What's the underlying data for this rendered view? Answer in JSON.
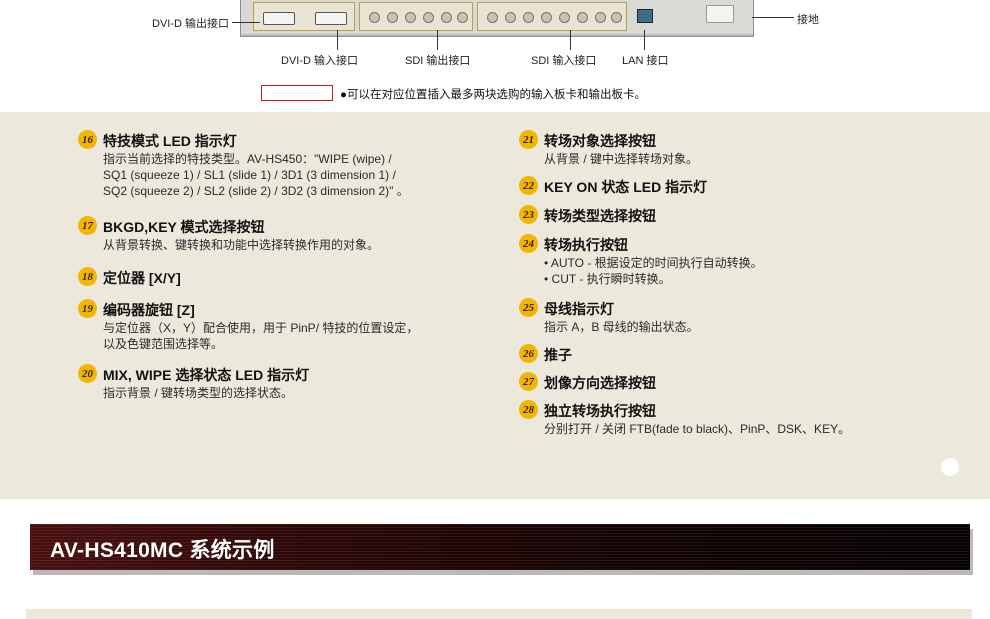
{
  "rear_panel": {
    "labels": {
      "dvi_out": "DVI-D 输出接口",
      "dvi_in": "DVI-D 输入接口",
      "sdi_out": "SDI 输出接口",
      "sdi_in": "SDI 输入接口",
      "lan": "LAN 接口",
      "ground": "接地"
    },
    "legend_note": "●可以在对应位置插入最多两块选购的输入板卡和输出板卡。"
  },
  "items": [
    {
      "num": "16",
      "title": "特技模式 LED 指示灯",
      "body": [
        "指示当前选择的特技类型。AV-HS450：\"WIPE (wipe) /",
        "SQ1 (squeeze 1) / SL1 (slide 1) / 3D1 (3 dimension 1) /",
        "SQ2 (squeeze 2) / SL2 (slide 2) / 3D2 (3 dimension 2)\" 。"
      ]
    },
    {
      "num": "17",
      "title": "BKGD,KEY 模式选择按钮",
      "body": [
        "从背景转换、键转换和功能中选择转换作用的对象。"
      ]
    },
    {
      "num": "18",
      "title": "定位器 [X/Y]",
      "body": []
    },
    {
      "num": "19",
      "title": "编码器旋钮 [Z]",
      "body": [
        "与定位器（X，Y）配合使用，用于 PinP/ 特技的位置设定，",
        "以及色键范围选择等。"
      ]
    },
    {
      "num": "20",
      "title": "MIX, WIPE 选择状态 LED 指示灯",
      "body": [
        "指示背景 / 键转场类型的选择状态。"
      ]
    },
    {
      "num": "21",
      "title": "转场对象选择按钮",
      "body": [
        "从背景 / 键中选择转场对象。"
      ]
    },
    {
      "num": "22",
      "title": "KEY ON 状态 LED 指示灯",
      "body": []
    },
    {
      "num": "23",
      "title": "转场类型选择按钮",
      "body": []
    },
    {
      "num": "24",
      "title": "转场执行按钮",
      "body": [
        "• AUTO - 根据设定的时间执行自动转换。",
        "• CUT - 执行瞬时转换。"
      ]
    },
    {
      "num": "25",
      "title": "母线指示灯",
      "body": [
        "指示 A，B 母线的输出状态。"
      ]
    },
    {
      "num": "26",
      "title": "推子",
      "body": []
    },
    {
      "num": "27",
      "title": "划像方向选择按钮",
      "body": []
    },
    {
      "num": "28",
      "title": "独立转场执行按钮",
      "body": [
        "分别打开 / 关闭 FTB(fade to black)、PinP、DSK、KEY。"
      ]
    }
  ],
  "section_banner": {
    "title": "AV-HS410MC 系统示例"
  },
  "colors": {
    "badge": "#f2b600",
    "beige": "#ece8dc",
    "banner_dark": "#120303",
    "legend_box": "#d0141b"
  }
}
